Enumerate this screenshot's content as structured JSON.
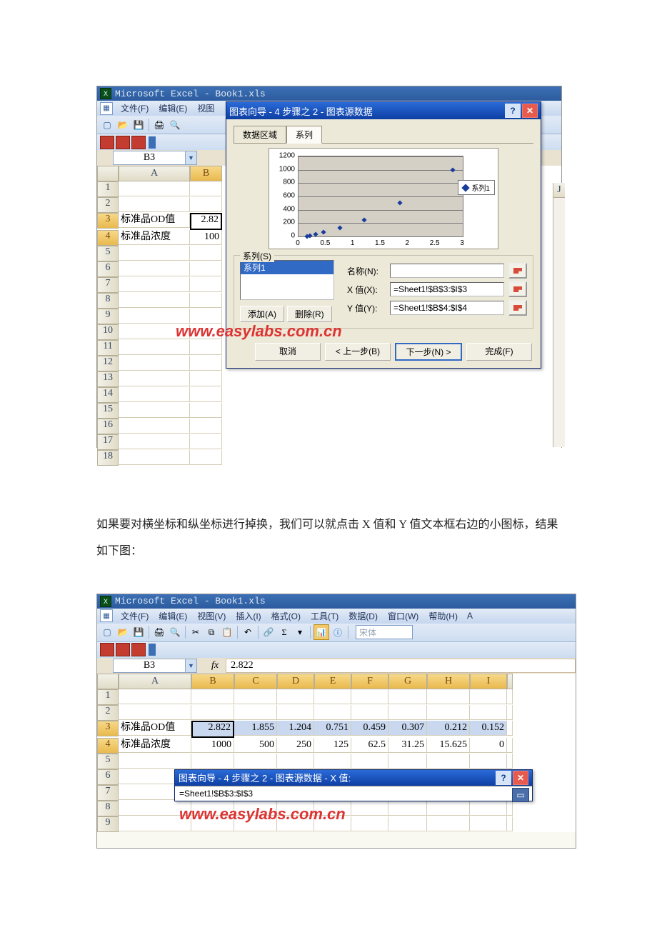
{
  "app_title": "Microsoft Excel - Book1.xls",
  "menus_short": [
    "文件(F)",
    "编辑(E)",
    "视图"
  ],
  "menus_full": [
    "文件(F)",
    "编辑(E)",
    "视图(V)",
    "插入(I)",
    "格式(O)",
    "工具(T)",
    "数据(D)",
    "窗口(W)",
    "帮助(H)"
  ],
  "font_name": "宋体",
  "namebox": "B3",
  "cols_narrow": [
    "A",
    "B"
  ],
  "cols_wide": [
    "A",
    "B",
    "C",
    "D",
    "E",
    "F",
    "G",
    "H",
    "I"
  ],
  "extra_col_j": "J",
  "rows_top": [
    1,
    2,
    3,
    4,
    5,
    6,
    7,
    8,
    9,
    10,
    11,
    12,
    13,
    14,
    15,
    16,
    17,
    18
  ],
  "rows_bottom": [
    1,
    2,
    3,
    4,
    5,
    6,
    7,
    8,
    9
  ],
  "labels": {
    "row3": "标准品OD值",
    "row4": "标准品浓度"
  },
  "b3_val_short": "2.82",
  "b4_val_short": "100",
  "od_values": [
    "2.822",
    "1.855",
    "1.204",
    "0.751",
    "0.459",
    "0.307",
    "0.212",
    "0.152"
  ],
  "conc_values": [
    "1000",
    "500",
    "250",
    "125",
    "62.5",
    "31.25",
    "15.625",
    "0"
  ],
  "formula_bar2": "2.822",
  "wizard": {
    "title": "图表向导 - 4 步骤之 2 - 图表源数据",
    "tab_range": "数据区域",
    "tab_series": "系列",
    "legend": "系列1",
    "series_group": "系列(S)",
    "series_item": "系列1",
    "name_label": "名称(N):",
    "x_label": "X 值(X):",
    "y_label": "Y 值(Y):",
    "x_formula": "=Sheet1!$B$3:$I$3",
    "y_formula": "=Sheet1!$B$4:$I$4",
    "add": "添加(A)",
    "remove": "删除(R)",
    "cancel": "取消",
    "back": "< 上一步(B)",
    "next": "下一步(N) >",
    "finish": "完成(F)"
  },
  "collapsed": {
    "title": "图表向导 - 4 步骤之 2 - 图表源数据 - X 值:",
    "formula": "=Sheet1!$B$3:$I$3"
  },
  "chart_data": {
    "type": "scatter",
    "x": [
      0.152,
      0.212,
      0.307,
      0.459,
      0.751,
      1.204,
      1.855,
      2.822
    ],
    "y": [
      0,
      15.625,
      31.25,
      62.5,
      125,
      250,
      500,
      1000
    ],
    "x_ticks": [
      0,
      0.5,
      1,
      1.5,
      2,
      2.5,
      3
    ],
    "y_ticks": [
      0,
      200,
      400,
      600,
      800,
      1000,
      1200
    ],
    "xlim": [
      0,
      3
    ],
    "ylim": [
      0,
      1200
    ],
    "series_name": "系列1"
  },
  "narrative": "如果要对横坐标和纵坐标进行掉换，我们可以就点击 X 值和 Y 值文本框右边的小图标，结果如下图：",
  "watermark": "www.easylabs.com.cn"
}
